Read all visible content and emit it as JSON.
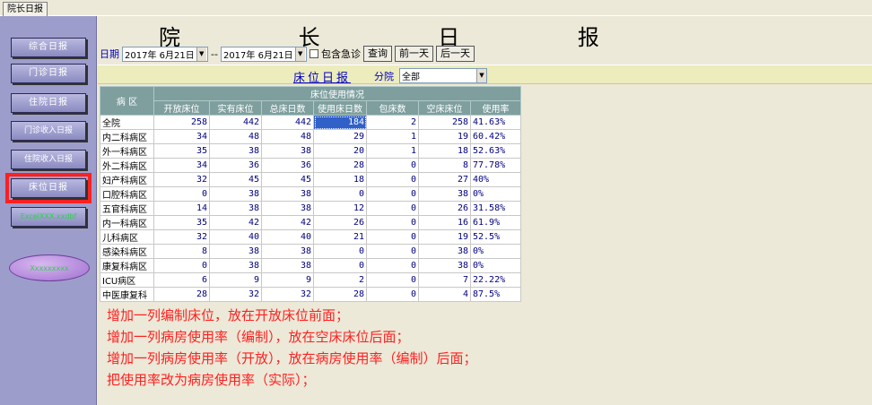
{
  "tab_title": "院长日报",
  "page_title": "院 长 日 报",
  "nav": {
    "items": [
      {
        "label": "综合日报"
      },
      {
        "label": "门诊日报"
      },
      {
        "label": "住院日报"
      },
      {
        "label": "门诊收入日报"
      },
      {
        "label": "住院收入日报"
      },
      {
        "label": "床位日报"
      },
      {
        "label": "ExcelXXX.xxdbf"
      }
    ],
    "pill_label": "Xxxxxxxxx"
  },
  "date_bar": {
    "date_label": "日期",
    "start_date": "2017年 6月21日",
    "separator": "--",
    "end_date": "2017年 6月21日",
    "include_emergency_label": "包含急诊",
    "query_button": "查询",
    "prev_button": "前一天",
    "next_button": "后一天"
  },
  "subbar": {
    "title": "床位日报",
    "dept_label": "分院",
    "dept_value": "全部"
  },
  "table": {
    "ward_header": "病 区",
    "group_header": "床位使用情况",
    "columns": [
      "开放床位",
      "实有床位",
      "总床日数",
      "使用床日数",
      "包床数",
      "空床床位",
      "使用率"
    ],
    "rows": [
      {
        "name": "全院",
        "v": [
          "258",
          "442",
          "442",
          "184",
          "2",
          "258",
          "41.63%"
        ]
      },
      {
        "name": "内二科病区",
        "v": [
          "34",
          "48",
          "48",
          "29",
          "1",
          "19",
          "60.42%"
        ]
      },
      {
        "name": "外一科病区",
        "v": [
          "35",
          "38",
          "38",
          "20",
          "1",
          "18",
          "52.63%"
        ]
      },
      {
        "name": "外二科病区",
        "v": [
          "34",
          "36",
          "36",
          "28",
          "0",
          "8",
          "77.78%"
        ]
      },
      {
        "name": "妇产科病区",
        "v": [
          "32",
          "45",
          "45",
          "18",
          "0",
          "27",
          "40%"
        ]
      },
      {
        "name": "口腔科病区",
        "v": [
          "0",
          "38",
          "38",
          "0",
          "0",
          "38",
          "0%"
        ]
      },
      {
        "name": "五官科病区",
        "v": [
          "14",
          "38",
          "38",
          "12",
          "0",
          "26",
          "31.58%"
        ]
      },
      {
        "name": "内一科病区",
        "v": [
          "35",
          "42",
          "42",
          "26",
          "0",
          "16",
          "61.9%"
        ]
      },
      {
        "name": "儿科病区",
        "v": [
          "32",
          "40",
          "40",
          "21",
          "0",
          "19",
          "52.5%"
        ]
      },
      {
        "name": "感染科病区",
        "v": [
          "8",
          "38",
          "38",
          "0",
          "0",
          "38",
          "0%"
        ]
      },
      {
        "name": "康复科病区",
        "v": [
          "0",
          "38",
          "38",
          "0",
          "0",
          "38",
          "0%"
        ]
      },
      {
        "name": "ICU病区",
        "v": [
          "6",
          "9",
          "9",
          "2",
          "0",
          "7",
          "22.22%"
        ]
      },
      {
        "name": "中医康复科",
        "v": [
          "28",
          "32",
          "32",
          "28",
          "0",
          "4",
          "87.5%"
        ]
      }
    ]
  },
  "notes": [
    "增加一列编制床位，放在开放床位前面；",
    "增加一列病房使用率（编制），放在空床床位后面；",
    "增加一列病房使用率（开放），放在病房使用率（编制）后面；",
    "把使用率改为病房使用率（实际）；"
  ],
  "colors": {
    "nav_bg": "#9d9dcb",
    "header_bg": "#7f9f9f",
    "selected_cell": "#3060c8",
    "note_red": "#ff2020",
    "highlight_frame": "#ff2020"
  }
}
